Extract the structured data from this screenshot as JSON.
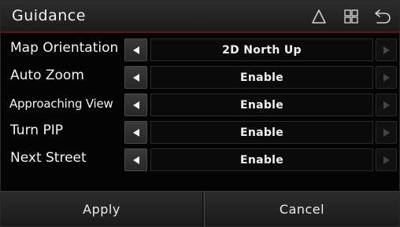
{
  "header": {
    "title": "Guidance",
    "icons": [
      "navigation-icon",
      "menu-grid-icon",
      "back-icon"
    ]
  },
  "settings": [
    {
      "label": "Map Orientation",
      "value": "2D North Up"
    },
    {
      "label": "Auto Zoom",
      "value": "Enable"
    },
    {
      "label": "Approaching View",
      "value": "Enable"
    },
    {
      "label": "Turn PIP",
      "value": "Enable"
    },
    {
      "label": "Next Street",
      "value": "Enable"
    }
  ],
  "footer": {
    "apply_label": "Apply",
    "cancel_label": "Cancel"
  },
  "colors": {
    "accent": "#6e0f16",
    "background": "#040404"
  }
}
